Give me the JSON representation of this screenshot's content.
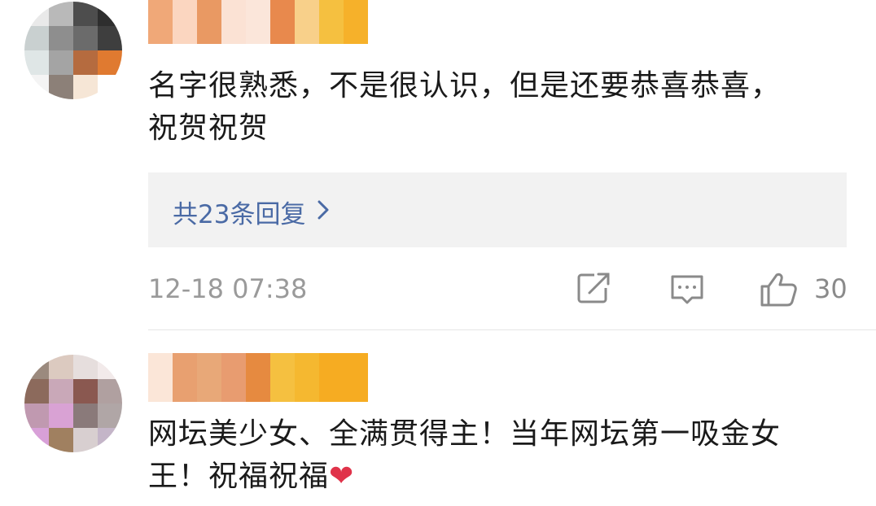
{
  "comments": [
    {
      "text": "名字很熟悉，不是很认识，但是还要恭喜恭喜，\n祝贺祝贺",
      "replies_label": "共23条回复",
      "timestamp": "12-18 07:38",
      "like_count": "30"
    },
    {
      "text": "网坛美少女、全满贯得主！当年网坛第一吸金女\n王！祝福祝福",
      "heart": "❤"
    }
  ],
  "icons": {
    "share": "share-icon",
    "comment": "comment-icon",
    "like": "thumbs-up-icon",
    "reply_chevron": "chevron-right-icon"
  },
  "colors": {
    "link": "#4a6aa5",
    "meta_text": "#9a9a9a",
    "reply_bg": "#f2f2f2",
    "heart": "#e0334a"
  }
}
